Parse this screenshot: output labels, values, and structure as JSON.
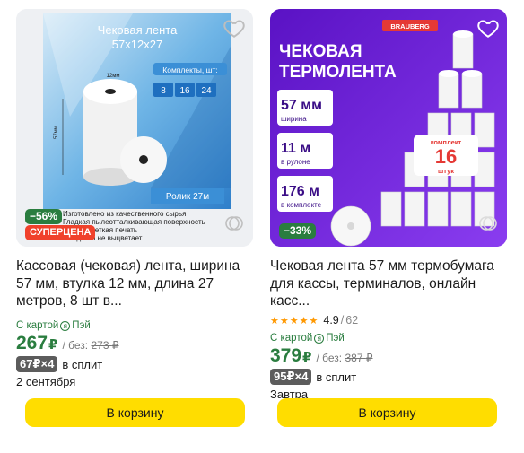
{
  "products": [
    {
      "image_texts": {
        "heading1": "Чековая лента",
        "heading2": "57x12x27",
        "sets_label": "Комплекты, шт:",
        "sets": [
          "8",
          "16",
          "24"
        ],
        "dim_12": "12мм",
        "dim_57": "57мм",
        "roll_label": "Ролик 27м",
        "features": [
          "Изготовлено из качественного сырья",
          "Гладкая пылеотталкивающая поверхность",
          "Яркая и четкая печать",
          "Чек долго не выцветает"
        ]
      },
      "badges": {
        "discount": "−56%",
        "super": "СУПЕРЦЕНА"
      },
      "title": "Кассовая (чековая) лента, ширина 57 мм, втулка 12 мм, длина 27 метров, 8 шт в...",
      "pay_prefix": "С картой",
      "pay_suffix": "Пэй",
      "price": "267",
      "currency": "₽",
      "old_prefix": "/ без:",
      "old_price": "273",
      "split_badge": "67₽×4",
      "split_text": "в сплит",
      "delivery": "2 сентября",
      "button": "В корзину"
    },
    {
      "image_texts": {
        "brand": "BRAUBERG",
        "heading1": "ЧЕКОВАЯ",
        "heading2": "ТЕРМОЛЕНТА",
        "spec1_value": "57 мм",
        "spec1_label": "ширина",
        "spec2_value": "11 м",
        "spec2_label": "в рулоне",
        "spec3_value": "176 м",
        "spec3_label": "в комплекте",
        "kit_top": "комплект",
        "kit_num": "16",
        "kit_bottom": "штук"
      },
      "badges": {
        "discount": "−33%"
      },
      "title": "Чековая лента 57 мм термобумага для кассы, терминалов, онлайн касс...",
      "rating": "4.9",
      "rating_sep": "/",
      "reviews": "62",
      "pay_prefix": "С картой",
      "pay_suffix": "Пэй",
      "price": "379",
      "currency": "₽",
      "old_prefix": "/ без:",
      "old_price": "387",
      "split_badge": "95₽×4",
      "split_text": "в сплит",
      "delivery": "Завтра",
      "button": "В корзину"
    }
  ],
  "colors": {
    "green": "#2a7d3f",
    "yellow": "#ffdd00",
    "purple": "#6d1fd0",
    "red": "#f0412b",
    "star": "#ff9800"
  },
  "icons": {
    "favorite": "heart-outline-icon",
    "similar": "similar-circles-icon",
    "rating": "star-icon",
    "pay": "ya-pay-icon"
  }
}
